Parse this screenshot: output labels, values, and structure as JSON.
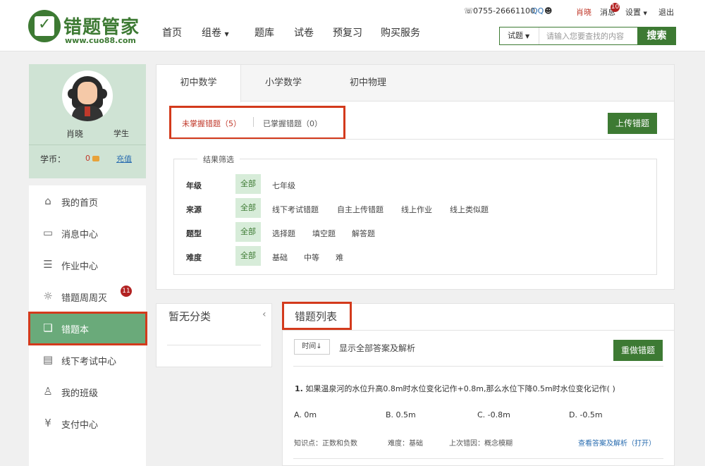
{
  "brand": {
    "name": "错题管家",
    "url": "www.cuo88.com"
  },
  "header": {
    "nav": [
      "首页",
      "组卷",
      "题库",
      "试卷",
      "预复习",
      "购买服务"
    ],
    "phone": "0755-26661100",
    "qq": "QQ",
    "user": "肖晓",
    "messages": "消息",
    "messages_count": "10",
    "settings": "设置",
    "logout": "退出"
  },
  "search": {
    "scope": "试题",
    "placeholder": "请输入您要查找的内容",
    "button": "搜索"
  },
  "profile": {
    "name": "肖晓",
    "role": "学生",
    "coin_label": "学币：",
    "coin_value": "0",
    "recharge": "充值"
  },
  "sidenav": [
    {
      "label": "我的首页",
      "icon": "home-icon"
    },
    {
      "label": "消息中心",
      "icon": "message-icon"
    },
    {
      "label": "作业中心",
      "icon": "homework-icon"
    },
    {
      "label": "错题周周灭",
      "icon": "bulb-icon",
      "badge": "11"
    },
    {
      "label": "错题本",
      "icon": "notebook-icon",
      "active": true
    },
    {
      "label": "线下考试中心",
      "icon": "exam-icon"
    },
    {
      "label": "我的班级",
      "icon": "class-icon"
    },
    {
      "label": "支付中心",
      "icon": "yen-icon"
    }
  ],
  "subject_tabs": [
    "初中数学",
    "小学数学",
    "初中物理"
  ],
  "status_tabs": {
    "unmastered": "未掌握错题（5）",
    "mastered": "已掌握错题（0）"
  },
  "upload_button": "上传错题",
  "filter": {
    "legend": "结果筛选",
    "rows": [
      {
        "label": "年级",
        "all": "全部",
        "options": [
          "七年级"
        ]
      },
      {
        "label": "来源",
        "all": "全部",
        "options": [
          "线下考试错题",
          "自主上传错题",
          "线上作业",
          "线上类似题"
        ]
      },
      {
        "label": "题型",
        "all": "全部",
        "options": [
          "选择题",
          "填空题",
          "解答题"
        ]
      },
      {
        "label": "难度",
        "all": "全部",
        "options": [
          "基础",
          "中等",
          "难"
        ]
      }
    ]
  },
  "category": {
    "title": "暂无分类"
  },
  "list": {
    "title": "错题列表",
    "sort": "时间↓",
    "show_all": "显示全部答案及解析",
    "redo": "重做错题",
    "question": {
      "number": "1.",
      "text": "如果温泉河的水位升高0.8m时水位变化记作+0.8m,那么水位下降0.5m时水位变化记作(      )",
      "options": [
        "A. 0m",
        "B. 0.5m",
        "C. -0.8m",
        "D. -0.5m"
      ],
      "knowledge": "知识点：正数和负数",
      "difficulty": "难度：基础",
      "last_reason": "上次错因：概念模糊",
      "view": "查看答案及解析（打开）"
    }
  }
}
